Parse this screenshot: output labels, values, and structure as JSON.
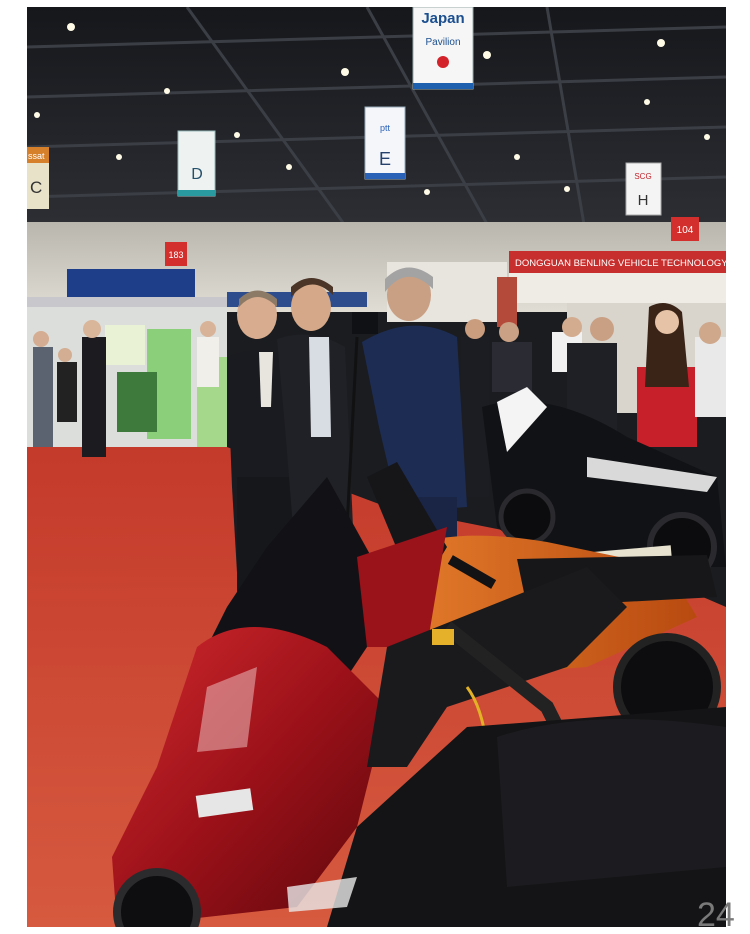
{
  "photo": {
    "description_free": true,
    "signs": {
      "japan_title": "Japan",
      "japan_sub": "Pavilion",
      "hall_c": "C",
      "hall_c_top": "ssat",
      "hall_d": "D",
      "hall_e": "E",
      "hall_e_logo": "ptt",
      "hall_h": "H",
      "hall_h_logo": "SCG",
      "booth_183": "183",
      "booth_104": "104",
      "company_banner": "DONGGUAN BENLING VEHICLE TECHNOLOGY"
    },
    "colors": {
      "carpet": "#c9402f",
      "scooter_red": "#a8141c",
      "scooter_orange": "#d9661b",
      "ceiling": "#1d1f24"
    }
  },
  "page_number": "24"
}
